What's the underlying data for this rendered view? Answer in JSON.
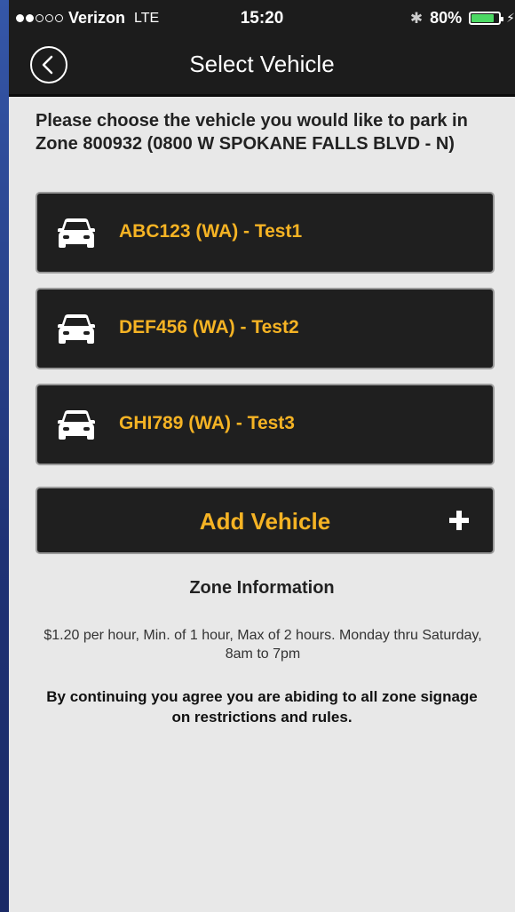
{
  "status_bar": {
    "carrier": "Verizon",
    "network": "LTE",
    "time": "15:20",
    "battery": "80%",
    "signal_bars_filled": 2,
    "signal_bars_total": 5
  },
  "nav": {
    "title": "Select Vehicle",
    "back_icon": "back-chevron-icon"
  },
  "prompt": "Please choose the vehicle you would like to park in Zone 800932 (0800 W SPOKANE FALLS BLVD - N)",
  "vehicles": [
    {
      "label": "ABC123 (WA) - Test1",
      "icon": "car-icon"
    },
    {
      "label": "DEF456 (WA) - Test2",
      "icon": "car-icon"
    },
    {
      "label": "GHI789 (WA) - Test3",
      "icon": "car-icon"
    }
  ],
  "add_vehicle": {
    "label": "Add Vehicle",
    "icon": "plus-icon"
  },
  "zone": {
    "heading": "Zone Information",
    "info": "$1.20 per hour, Min. of 1 hour, Max of 2 hours. Monday thru Saturday, 8am to 7pm"
  },
  "agreement": "By continuing you agree you are abiding to all zone signage on restrictions and rules.",
  "colors": {
    "accent": "#f5b324",
    "header_bg": "#1c1c1c",
    "button_bg": "#1f1f1f",
    "page_bg": "#e8e8e8"
  }
}
